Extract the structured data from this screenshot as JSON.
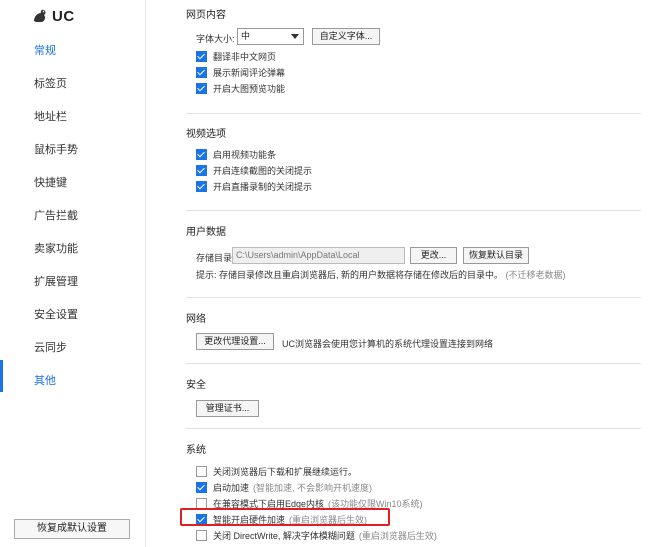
{
  "brand": {
    "logo_text": "UC"
  },
  "sidebar": {
    "items": [
      {
        "label": "常规"
      },
      {
        "label": "标签页"
      },
      {
        "label": "地址栏"
      },
      {
        "label": "鼠标手势"
      },
      {
        "label": "快捷键"
      },
      {
        "label": "广告拦截"
      },
      {
        "label": "卖家功能"
      },
      {
        "label": "扩展管理"
      },
      {
        "label": "安全设置"
      },
      {
        "label": "云同步"
      },
      {
        "label": "其他"
      }
    ],
    "restore_button": "恢复成默认设置"
  },
  "sections": {
    "web_content": {
      "title": "网页内容",
      "font_size_label": "字体大小:",
      "font_size_value": "中",
      "custom_font_button": "自定义字体...",
      "options": [
        {
          "label": "翻译非中文网页",
          "checked": true
        },
        {
          "label": "展示新闻评论弹幕",
          "checked": true
        },
        {
          "label": "开启大图预览功能",
          "checked": true
        }
      ]
    },
    "video": {
      "title": "视频选项",
      "options": [
        {
          "label": "启用视频功能条",
          "checked": true
        },
        {
          "label": "开启连续截图的关闭提示",
          "checked": true
        },
        {
          "label": "开启直播录制的关闭提示",
          "checked": true
        }
      ]
    },
    "user_data": {
      "title": "用户数据",
      "storage_label": "存储目录:",
      "storage_path": "C:\\Users\\admin\\AppData\\Local",
      "change_button": "更改...",
      "restore_dir_button": "恢复默认目录",
      "hint": "提示: 存储目录修改且重启浏览器后, 新的用户数据将存储在修改后的目录中。",
      "hint_note": "(不迁移老数据)"
    },
    "network": {
      "title": "网络",
      "proxy_button": "更改代理设置...",
      "proxy_desc": "UC浏览器会使用您计算机的系统代理设置连接到网络"
    },
    "security": {
      "title": "安全",
      "cert_button": "管理证书..."
    },
    "system": {
      "title": "系统",
      "options": [
        {
          "label": "关闭浏览器后下载和扩展继续运行。",
          "note": "",
          "checked": false
        },
        {
          "label": "启动加速",
          "note": "(智能加速, 不会影响开机速度)",
          "checked": true
        },
        {
          "label": "在兼容模式下启用Edge内核",
          "note": "(该功能仅限Win10系统)",
          "checked": false
        },
        {
          "label": "智能开启硬件加速",
          "note": "(重启浏览器后生效)",
          "checked": true
        },
        {
          "label": "关闭 DirectWrite, 解决字体模糊问题",
          "note": "(重启浏览器后生效)",
          "checked": false
        }
      ]
    }
  },
  "colors": {
    "accent": "#1a73e8",
    "highlight": "#e02020"
  }
}
